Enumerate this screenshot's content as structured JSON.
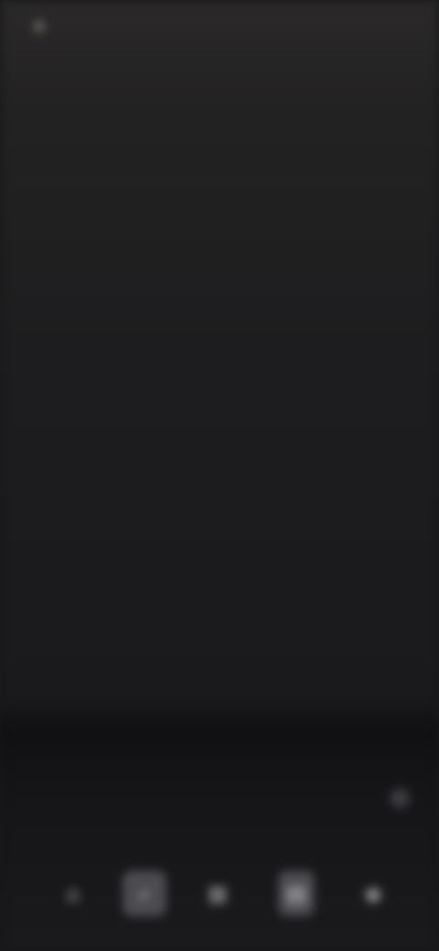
{
  "status_bar": {
    "app_name": "",
    "right_text": ""
  },
  "header": {
    "title": ""
  },
  "menu": {
    "items": [
      {
        "label": ""
      },
      {
        "label": ""
      },
      {
        "label": ""
      },
      {
        "label": ""
      },
      {
        "label": ""
      },
      {
        "label": ""
      },
      {
        "label": ""
      },
      {
        "label": ""
      },
      {
        "label": ""
      },
      {
        "label": ""
      },
      {
        "label": ""
      }
    ]
  },
  "lower": {
    "link_label": "",
    "panel_label": "",
    "panel_sublabel": ""
  },
  "bottom_nav": {
    "items": [
      {
        "icon": "home-icon",
        "glyph": "⌂"
      },
      {
        "icon": "search-icon",
        "glyph": "⌕"
      },
      {
        "icon": "grid-icon",
        "glyph": "▦"
      },
      {
        "icon": "library-icon",
        "glyph": "▤"
      },
      {
        "icon": "profile-icon",
        "glyph": "◉"
      }
    ]
  },
  "colors": {
    "background": "#1a1a1c",
    "text": "#9a9a9d",
    "active_tab": "#4b4b50"
  }
}
